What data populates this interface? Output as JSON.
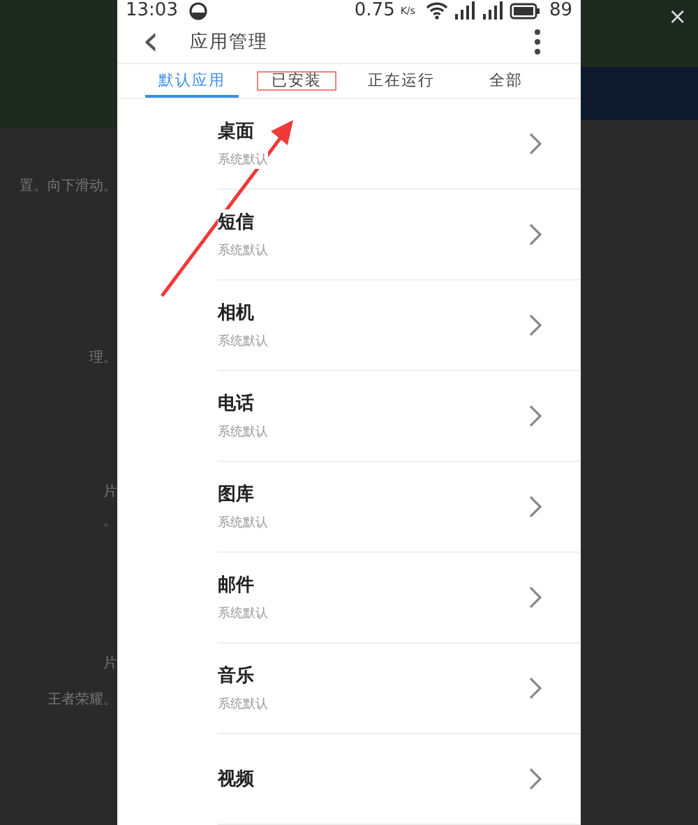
{
  "background": {
    "left_texts": [
      "置。向下滑动。",
      "理。",
      "片",
      "。",
      "片",
      "王者荣耀。"
    ],
    "close": "×"
  },
  "status_bar": {
    "time": "13:03",
    "speed": "0.75",
    "speed_unit": "K/s",
    "battery": "89"
  },
  "header": {
    "back": "‹",
    "title": "应用管理"
  },
  "tabs": [
    {
      "label": "默认应用",
      "selected": true,
      "highlighted": false
    },
    {
      "label": "已安装",
      "selected": false,
      "highlighted": true
    },
    {
      "label": "正在运行",
      "selected": false,
      "highlighted": false
    },
    {
      "label": "全部",
      "selected": false,
      "highlighted": false
    }
  ],
  "apps": [
    {
      "name": "桌面",
      "subtitle": "系统默认"
    },
    {
      "name": "短信",
      "subtitle": "系统默认"
    },
    {
      "name": "相机",
      "subtitle": "系统默认"
    },
    {
      "name": "电话",
      "subtitle": "系统默认"
    },
    {
      "name": "图库",
      "subtitle": "系统默认"
    },
    {
      "name": "邮件",
      "subtitle": "系统默认"
    },
    {
      "name": "音乐",
      "subtitle": "系统默认"
    },
    {
      "name": "视频"
    }
  ]
}
